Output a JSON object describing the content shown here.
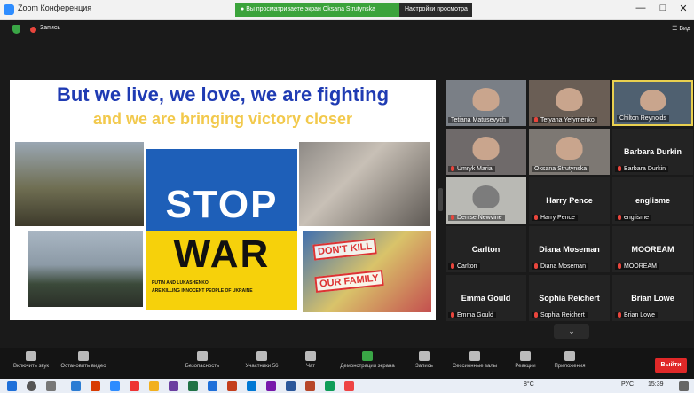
{
  "window": {
    "title": "Zoom Конференция",
    "minimize": "—",
    "maximize": "□",
    "close": "✕"
  },
  "banner": {
    "share_text": "Вы просматриваете экран Oksana Strutynska",
    "view_options": "Настройки просмотра"
  },
  "topbar": {
    "record_label": "Запись",
    "view_label": "Вид"
  },
  "slide": {
    "line1": "But we live, we love, we are fighting",
    "line2": "and we are bringing victory closer",
    "stop": "STOP",
    "war": "WAR",
    "caption1": "PUTIN AND LUKASHENKO",
    "caption2": "ARE KILLING INNOCENT PEOPLE OF UKRAINE",
    "sign1": "DON'T KILL",
    "sign2": "OUR FAMILY"
  },
  "participants": [
    {
      "name": "Tetiana Matusevych",
      "video": true,
      "muted": false
    },
    {
      "name": "Tetyana Yefymenko",
      "video": true,
      "muted": true
    },
    {
      "name": "Chilton Reynolds",
      "video": true,
      "muted": false,
      "speaking": true
    },
    {
      "name": "Umryk Maria",
      "video": true,
      "muted": true
    },
    {
      "name": "Oksana Strutynska",
      "video": true,
      "muted": false
    },
    {
      "name": "Barbara Durkin",
      "video": false,
      "muted": true
    },
    {
      "name": "Denise Newvine",
      "video": true,
      "muted": true
    },
    {
      "name": "Harry Pence",
      "video": false,
      "muted": true
    },
    {
      "name": "englisme",
      "video": false,
      "muted": true
    },
    {
      "name": "Carlton",
      "video": false,
      "muted": true
    },
    {
      "name": "Diana Moseman",
      "video": false,
      "muted": true
    },
    {
      "name": "MOOREAM",
      "video": false,
      "muted": true
    },
    {
      "name": "Emma Gould",
      "video": false,
      "muted": true
    },
    {
      "name": "Sophia Reichert",
      "video": false,
      "muted": true
    },
    {
      "name": "Brian Lowe",
      "video": false,
      "muted": true
    }
  ],
  "toolbar": {
    "unmute": "Включить звук",
    "start_video": "Остановить видео",
    "security": "Безопасность",
    "participants": "Участники",
    "participants_count": "56",
    "chat": "Чат",
    "share": "Демонстрация экрана",
    "record": "Запись",
    "breakout": "Сессионные залы",
    "reactions": "Реакции",
    "apps": "Приложения",
    "leave": "Выйти"
  },
  "taskbar": {
    "weather": "8°C",
    "lang": "РУС",
    "time": "15:39"
  },
  "colors": {
    "slide_title": "#1f3bb3",
    "slide_subtitle": "#f2c94c",
    "stop_blue": "#1e5fb8",
    "war_yellow": "#f6d10b",
    "share_green": "#3ba33b",
    "leave_red": "#e02828"
  }
}
